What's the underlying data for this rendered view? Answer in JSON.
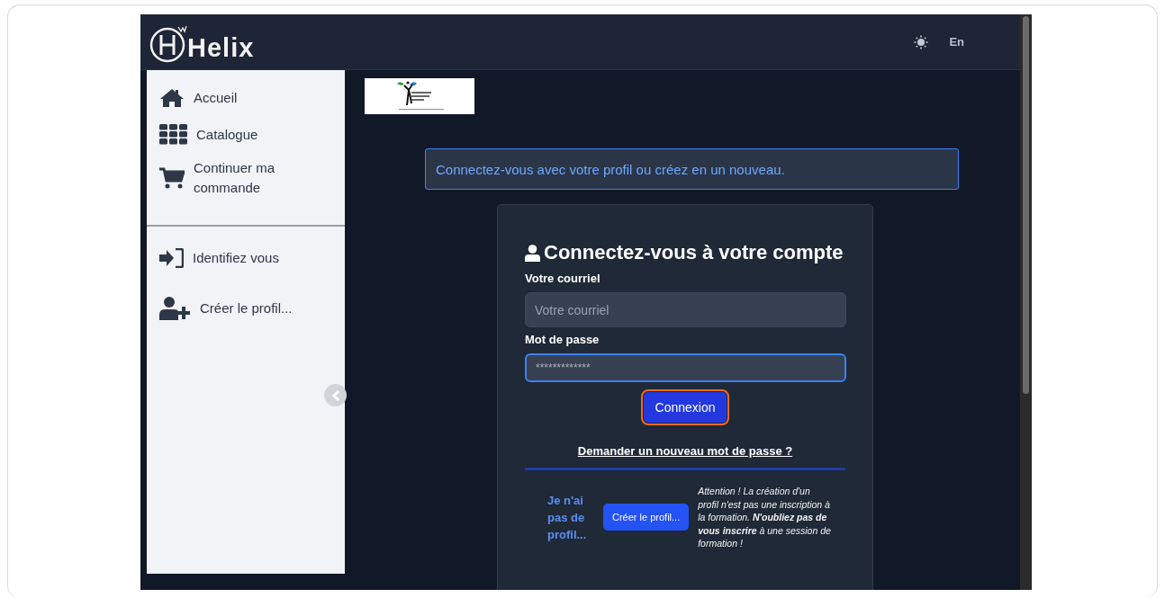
{
  "header": {
    "brand": "Helix",
    "language": "En"
  },
  "sidebar": {
    "items": [
      {
        "label": "Accueil",
        "kind": "home"
      },
      {
        "label": "Catalogue",
        "kind": "grid"
      },
      {
        "label": "Continuer ma commande",
        "kind": "cart"
      }
    ],
    "account_items": [
      {
        "label": "Identifiez vous",
        "kind": "signin"
      },
      {
        "label": "Créer le profil...",
        "kind": "userplus"
      }
    ]
  },
  "main": {
    "alert": "Connectez-vous avec votre profil ou créez en un nouveau.",
    "login": {
      "title": "Connectez-vous à votre compte",
      "fields": [
        {
          "label": "Votre courriel",
          "placeholder": "Votre courriel",
          "focused": false
        },
        {
          "label": "Mot de passe",
          "value": "*************",
          "focused": true
        }
      ],
      "submit": {
        "label": "Connexion",
        "focused": true
      },
      "forgot_link": "Demander un nouveau mot de passe ?",
      "signup": {
        "prompt": "Je n'ai pas de profil...",
        "button": "Créer le profil...",
        "note": "Attention ! La création d'un profil n'est pas une inscription à la formation. **N'oubliez pas de vous inscrire** à une session de formation !"
      }
    }
  }
}
